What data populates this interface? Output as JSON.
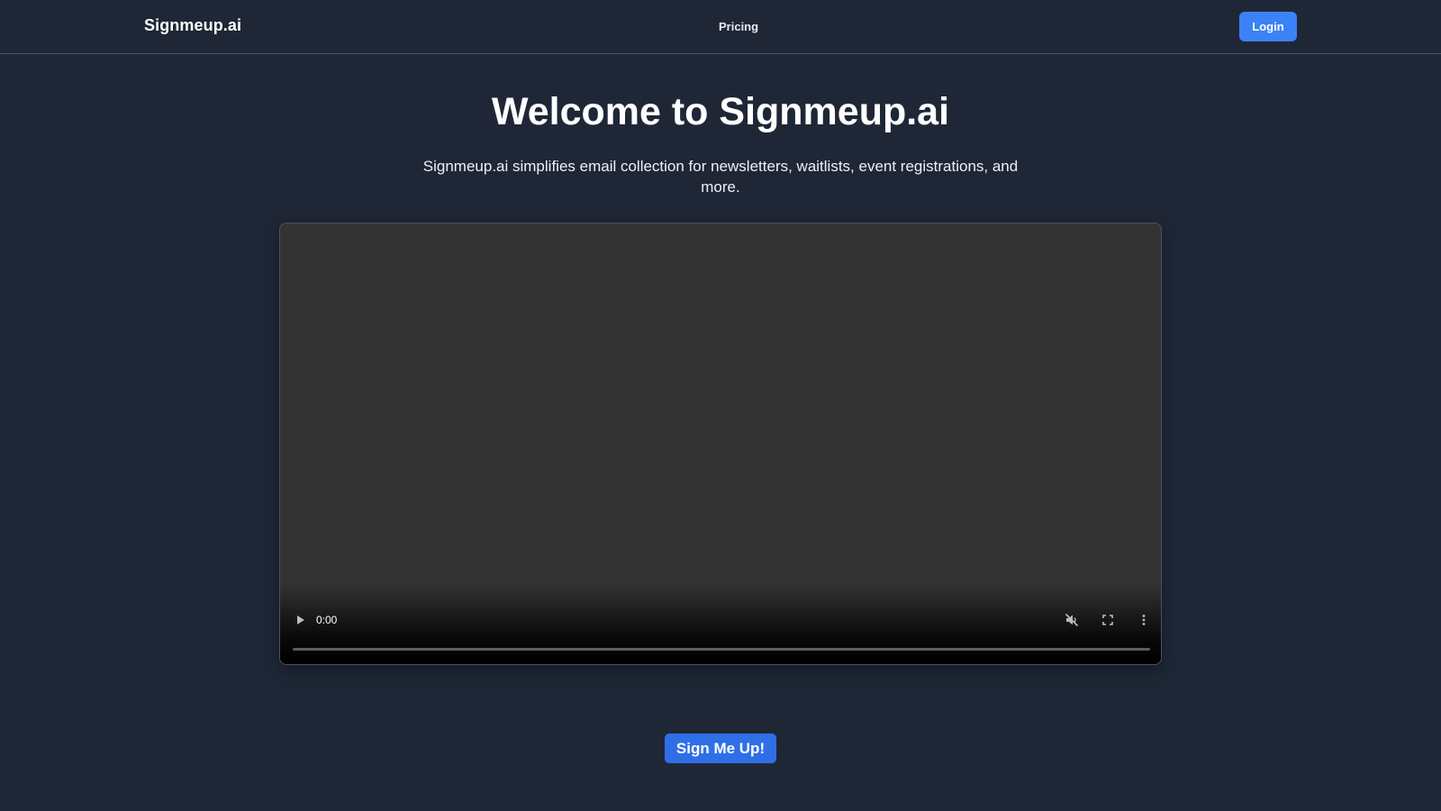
{
  "nav": {
    "brand": "Signmeup.ai",
    "links": [
      {
        "label": "Pricing"
      }
    ],
    "login_label": "Login"
  },
  "hero": {
    "title": "Welcome to Signmeup.ai",
    "subtitle": "Signmeup.ai simplifies email collection for newsletters, waitlists, event registrations, and more."
  },
  "video": {
    "current_time": "0:00",
    "progress": 0,
    "icons": [
      "play-icon",
      "mute-icon",
      "fullscreen-icon",
      "more-options-icon"
    ]
  },
  "cta": {
    "label": "Sign Me Up!"
  },
  "colors": {
    "background": "#1f2737",
    "primary": "#3b82f6",
    "cta": "#2f6fe6",
    "video_bg": "#333333"
  }
}
